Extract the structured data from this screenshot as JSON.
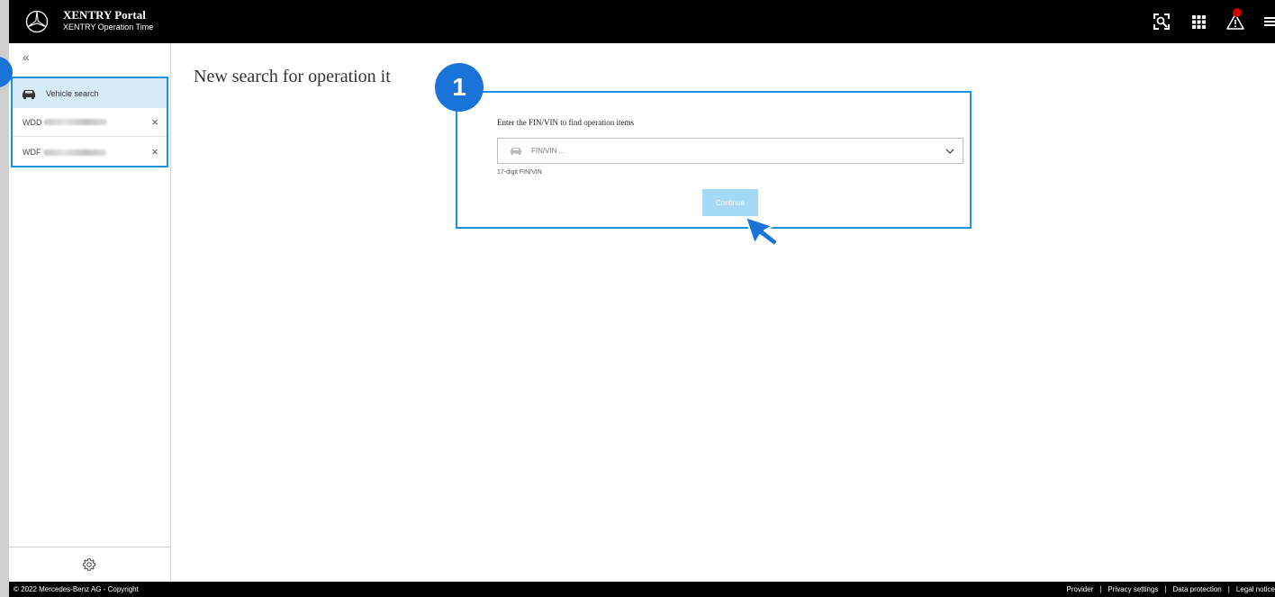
{
  "header": {
    "title": "XENTRY Portal",
    "subtitle": "XENTRY Operation Time",
    "icons": [
      "vin-scan-icon",
      "apps-grid-icon",
      "warning-icon",
      "menu-icon"
    ],
    "colors": {
      "background": "#000000",
      "alert": "#d40000"
    }
  },
  "sidebar": {
    "collapse_label": "«",
    "items": [
      {
        "label": "Vehicle search",
        "icon": "car-icon",
        "active": true
      },
      {
        "vin_prefix": "WDD",
        "close": "×"
      },
      {
        "vin_prefix": "WDF",
        "close": "×"
      }
    ],
    "settings_icon": "gear-icon",
    "accent": "#1f8fe0",
    "active_bg": "#d6ebf7"
  },
  "main": {
    "title": "New search for operation it",
    "search_card": {
      "label": "Enter the FIN/VIN to find operation items",
      "placeholder": "FIN/VIN ...",
      "hint": "17-digit FIN/VIN",
      "button_label": "Continue",
      "button_color": "#a3d9f5"
    },
    "callout_number": "1",
    "callout_color": "#1a73d9"
  },
  "footer": {
    "copyright": "© 2022 Mercedes-Benz AG - Copyright",
    "links": [
      "Provider",
      "Privacy settings",
      "Data protection",
      "Legal notice"
    ],
    "separator": "|"
  }
}
